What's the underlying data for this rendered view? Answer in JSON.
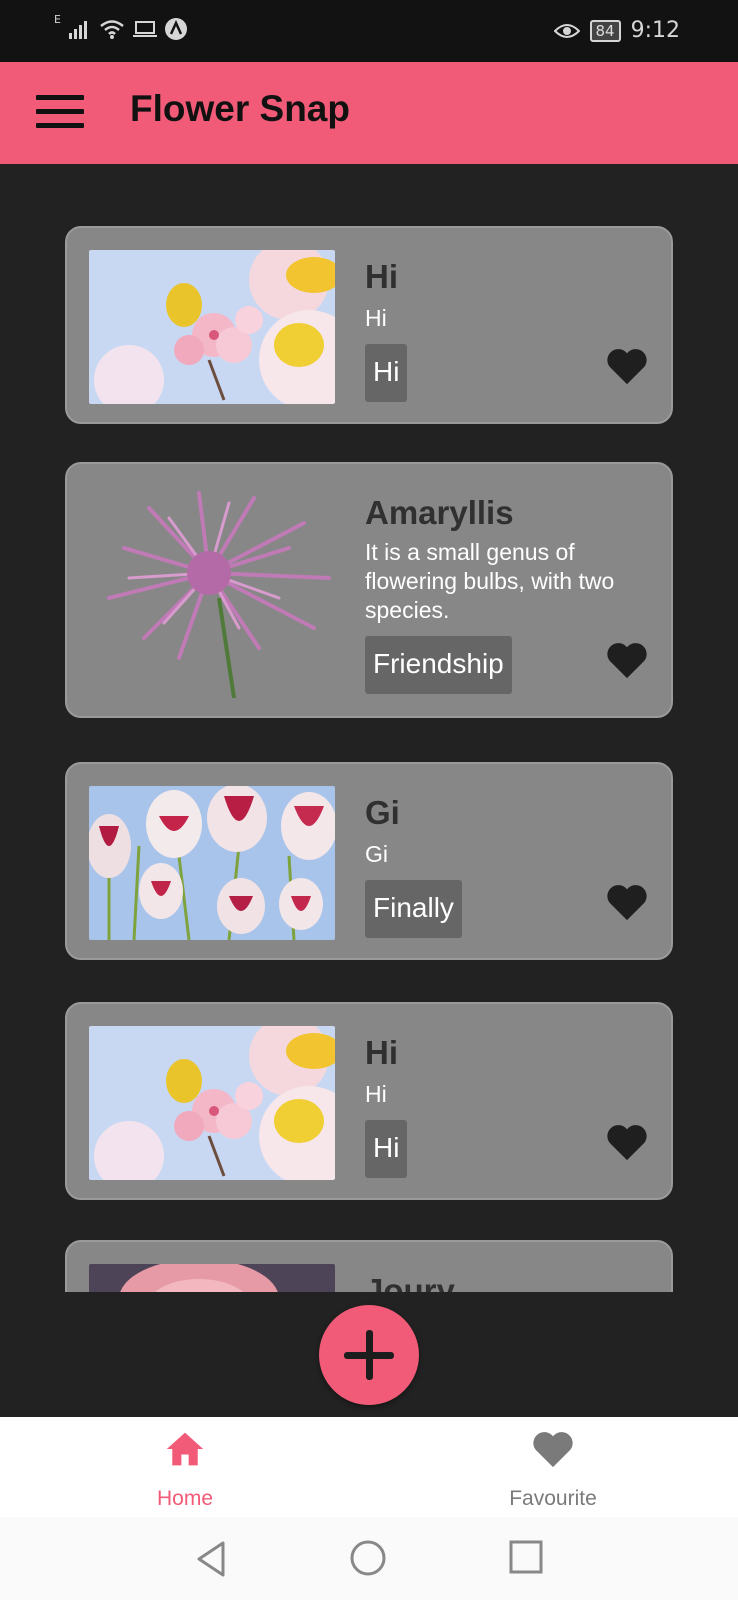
{
  "status_bar": {
    "time": "9:12",
    "battery": "84",
    "network_indicator": "E",
    "icons": [
      "signal-icon",
      "wifi-icon",
      "laptop-icon",
      "vpn-icon",
      "eye-icon",
      "battery-icon"
    ]
  },
  "app_bar": {
    "title": "Flower Snap",
    "menu_icon": "hamburger-menu-icon",
    "background": "#f15b78"
  },
  "cards": [
    {
      "title": "Hi",
      "description": "Hi",
      "tag": "Hi",
      "image": "pink-yellow-blossoms"
    },
    {
      "title": "Amaryllis",
      "description": " It is a small genus of flowering bulbs, with two species.",
      "tag": "Friendship",
      "image": "purple-chrysanthemum"
    },
    {
      "title": "Gi",
      "description": "Gi",
      "tag": "Finally",
      "image": "red-white-tulips"
    },
    {
      "title": "Hi",
      "description": "Hi",
      "tag": "Hi",
      "image": "pink-yellow-blossoms"
    },
    {
      "title": "Joury",
      "image": "pink-rose"
    }
  ],
  "fab": {
    "icon": "plus-icon"
  },
  "bottom_nav": {
    "items": [
      {
        "label": "Home",
        "icon": "home-icon",
        "active": true,
        "color": "#f15b78"
      },
      {
        "label": "Favourite",
        "icon": "heart-icon",
        "active": false,
        "color": "#7a7a7a"
      }
    ]
  },
  "system_nav": {
    "icons": [
      "back-icon",
      "home-circle-icon",
      "recents-icon"
    ]
  }
}
